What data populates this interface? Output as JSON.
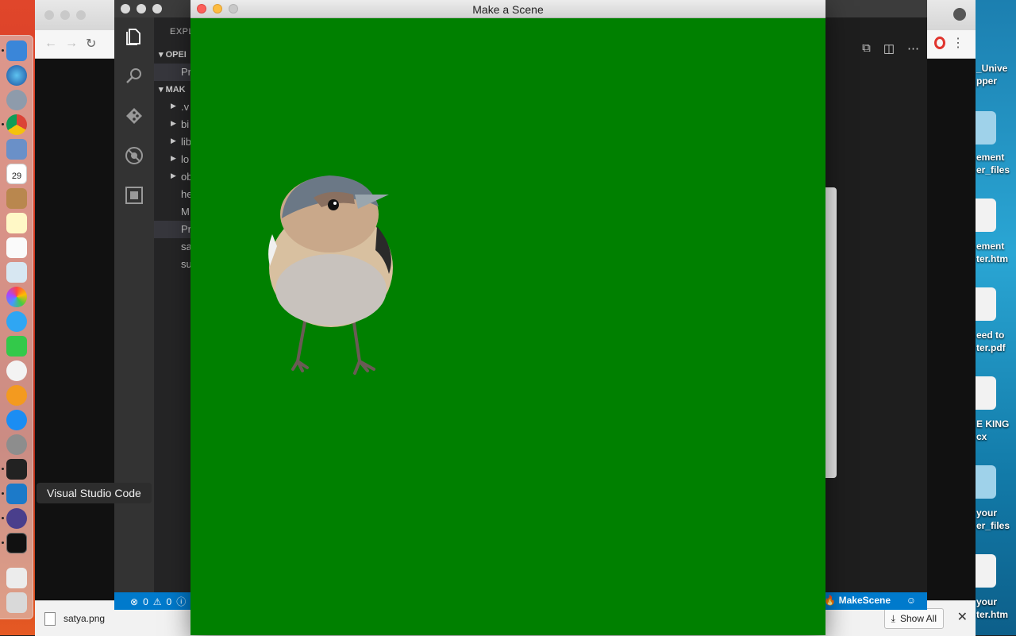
{
  "scene_window": {
    "title": "Make a Scene",
    "background_color": "#008000",
    "sprite": "bird"
  },
  "dock": {
    "tooltip": "Visual Studio Code",
    "calendar_day": "29"
  },
  "vscode": {
    "sidebar": {
      "title": "EXPL",
      "sections": [
        {
          "label": "OPEI"
        },
        {
          "label": "MAK"
        }
      ],
      "open_editors": [
        {
          "label": "Pr"
        }
      ],
      "tree": [
        {
          "label": ".v",
          "folder": true
        },
        {
          "label": "bi",
          "folder": true
        },
        {
          "label": "lib",
          "folder": true
        },
        {
          "label": "lo",
          "folder": true
        },
        {
          "label": "ob",
          "folder": true
        },
        {
          "label": "he",
          "folder": false
        },
        {
          "label": "M",
          "folder": false
        },
        {
          "label": "Pr",
          "folder": false
        },
        {
          "label": "sa",
          "folder": false
        },
        {
          "label": "su",
          "folder": false
        }
      ]
    },
    "status": {
      "errors": "0",
      "warnings": "0",
      "project": "MakeScene"
    }
  },
  "chrome": {
    "download_file": "satya.png",
    "show_all": "Show All"
  },
  "desktop_labels": [
    "_Unive",
    "pper",
    "ement",
    "er_files",
    "ement",
    "ter.htm",
    "eed to",
    "ter.pdf",
    "E KING",
    "cx",
    "your",
    "er_files",
    "your",
    "ter.htm"
  ]
}
